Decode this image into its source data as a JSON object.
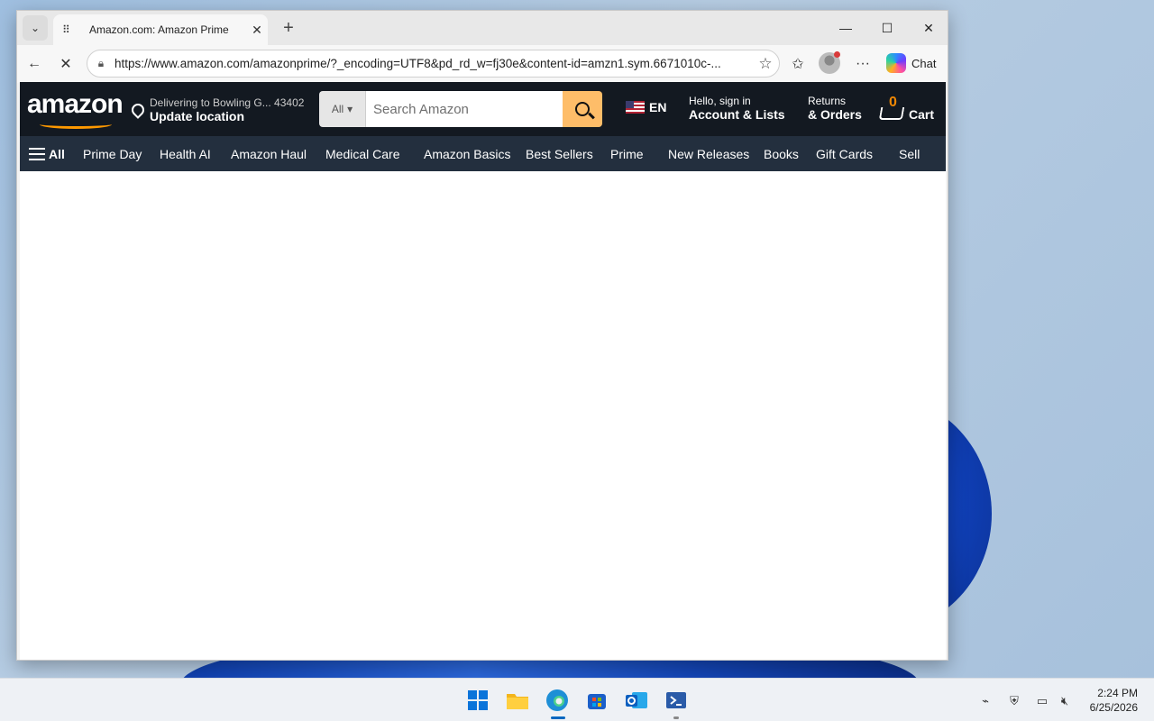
{
  "browser": {
    "tab_title": "Amazon.com: Amazon Prime",
    "tab_spinner": "⠿",
    "url": "https://www.amazon.com/amazonprime/?_encoding=UTF8&pd_rd_w=fj30e&content-id=amzn1.sym.6671010c-...",
    "copilot_label": "Chat",
    "icons": [
      "tab-list-icon",
      "close-icon",
      "plus-icon",
      "minimize-icon",
      "maximize-icon",
      "back-icon",
      "stop-icon",
      "lock-icon",
      "star-icon",
      "favorites-icon",
      "more-icon"
    ]
  },
  "amazon": {
    "logo": "amazon",
    "deliver_line1": "Delivering to Bowling G... 43402",
    "deliver_line2": "Update location",
    "search_category": "All",
    "search_placeholder": "Search Amazon",
    "language": "EN",
    "account_line1": "Hello, sign in",
    "account_line2": "Account & Lists",
    "returns_line1": "Returns",
    "returns_line2": "& Orders",
    "cart_count": "0",
    "cart_label": "Cart",
    "menu_label": "All",
    "nav_items": [
      "Prime Day",
      "Health AI",
      "Amazon Haul",
      "Medical Care",
      "Amazon Basics",
      "Best Sellers",
      "Prime",
      "New Releases",
      "Books",
      "Gift Cards",
      "Sell"
    ]
  },
  "taskbar": {
    "time": "2:24 PM",
    "date": "6/25/2026",
    "apps": [
      "start-icon",
      "file-explorer-icon",
      "edge-icon",
      "store-icon",
      "outlook-icon",
      "terminal-icon"
    ]
  }
}
